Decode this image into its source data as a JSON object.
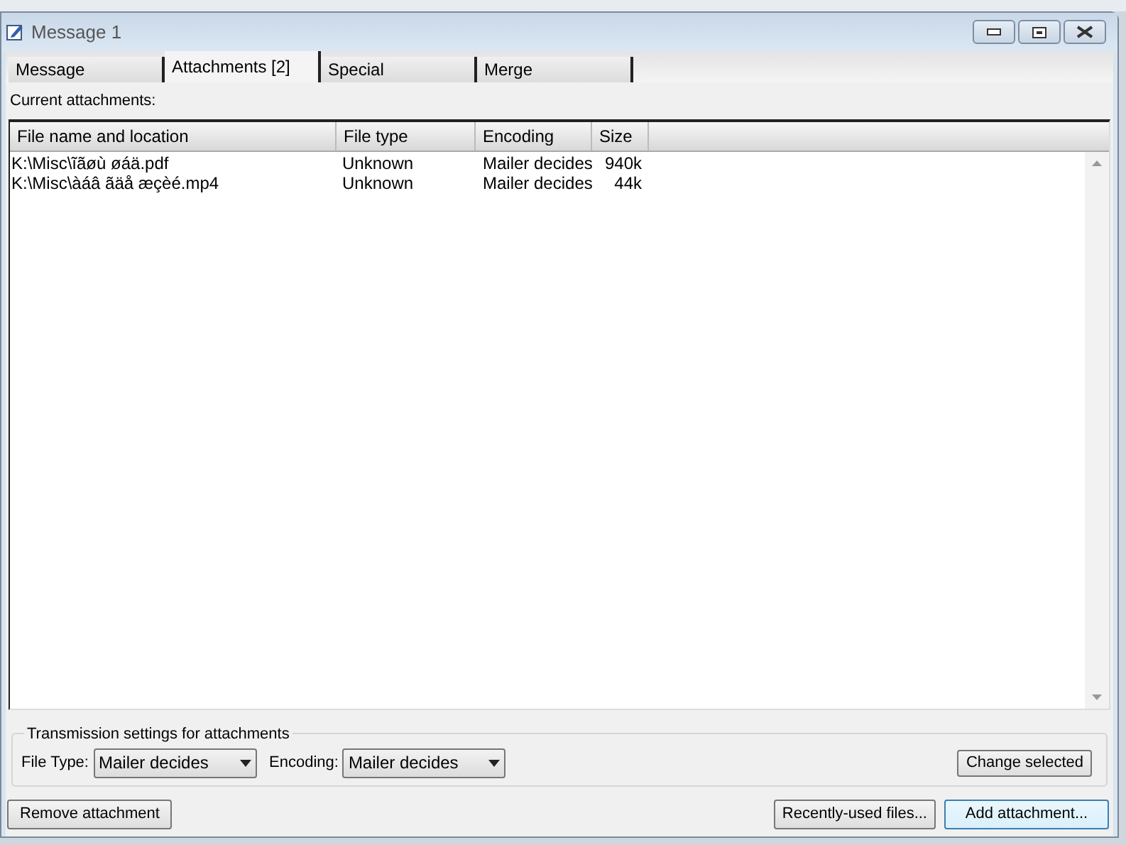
{
  "window": {
    "title": "Message 1"
  },
  "tabs": [
    {
      "label": "Message",
      "selected": false
    },
    {
      "label": "Attachments [2]",
      "selected": true
    },
    {
      "label": "Special",
      "selected": false
    },
    {
      "label": "Merge",
      "selected": false
    }
  ],
  "attachments_label": "Current attachments:",
  "table": {
    "columns": [
      "File name and location",
      "File type",
      "Encoding",
      "Size"
    ],
    "rows": [
      [
        "K:\\Misc\\ĩãøù øáä.pdf",
        "Unknown",
        "Mailer decides",
        "940k"
      ],
      [
        "K:\\Misc\\àáâ ãäå æçèé.mp4",
        "Unknown",
        "Mailer decides",
        "44k"
      ]
    ]
  },
  "transmission": {
    "title": "Transmission settings for attachments",
    "file_type_label": "File Type:",
    "file_type_value": "Mailer decides",
    "encoding_label": "Encoding:",
    "encoding_value": "Mailer decides",
    "change_button": "Change selected"
  },
  "buttons": {
    "remove": "Remove attachment",
    "recent": "Recently-used files...",
    "add": "Add attachment..."
  }
}
